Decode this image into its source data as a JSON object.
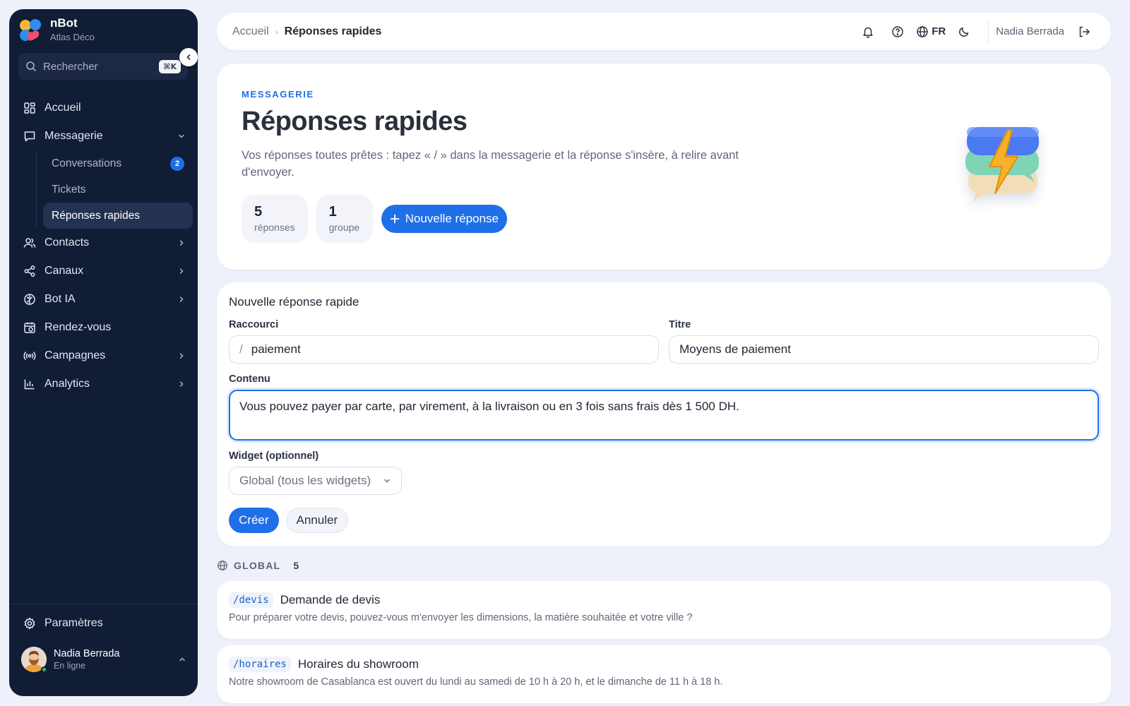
{
  "brand": {
    "name": "nBot",
    "workspace": "Atlas Déco"
  },
  "search": {
    "placeholder": "Rechercher",
    "shortcut": "⌘K"
  },
  "nav": {
    "home": "Accueil",
    "messaging": "Messagerie",
    "sub": {
      "conversations": "Conversations",
      "conversations_badge": "2",
      "tickets": "Tickets",
      "quick_replies": "Réponses rapides"
    },
    "contacts": "Contacts",
    "channels": "Canaux",
    "bot": "Bot IA",
    "appointments": "Rendez-vous",
    "campaigns": "Campagnes",
    "analytics": "Analytics",
    "settings": "Paramètres"
  },
  "user": {
    "name": "Nadia Berrada",
    "status": "En ligne"
  },
  "topbar": {
    "breadcrumb_home": "Accueil",
    "breadcrumb_current": "Réponses rapides",
    "lang": "FR",
    "user": "Nadia Berrada"
  },
  "hero": {
    "eyebrow": "MESSAGERIE",
    "title": "Réponses rapides",
    "description": "Vos réponses toutes prêtes : tapez « / » dans la messagerie et la réponse s'insère, à relire avant d'envoyer.",
    "stats": [
      {
        "value": "5",
        "label": "réponses"
      },
      {
        "value": "1",
        "label": "groupe"
      }
    ],
    "new_button": "Nouvelle réponse"
  },
  "form": {
    "title": "Nouvelle réponse rapide",
    "shortcut_label": "Raccourci",
    "shortcut_prefix": "/",
    "shortcut_value": "paiement",
    "title_label": "Titre",
    "title_value": "Moyens de paiement",
    "content_label": "Contenu",
    "content_value": "Vous pouvez payer par carte, par virement, à la livraison ou en 3 fois sans frais dès 1 500 DH.",
    "widget_label": "Widget (optionnel)",
    "widget_value": "Global (tous les widgets)",
    "create": "Créer",
    "cancel": "Annuler"
  },
  "group": {
    "name": "GLOBAL",
    "count": "5"
  },
  "replies": [
    {
      "shortcut": "/devis",
      "title": "Demande de devis",
      "text": "Pour préparer votre devis, pouvez-vous m'envoyer les dimensions, la matière souhaitée et votre ville ?"
    },
    {
      "shortcut": "/horaires",
      "title": "Horaires du showroom",
      "text": "Notre showroom de Casablanca est ouvert du lundi au samedi de 10 h à 20 h, et le dimanche de 11 h à 18 h."
    }
  ],
  "colors": {
    "accent": "#1f6fe8",
    "sidebar": "#111c35",
    "background": "#eef1f9"
  }
}
